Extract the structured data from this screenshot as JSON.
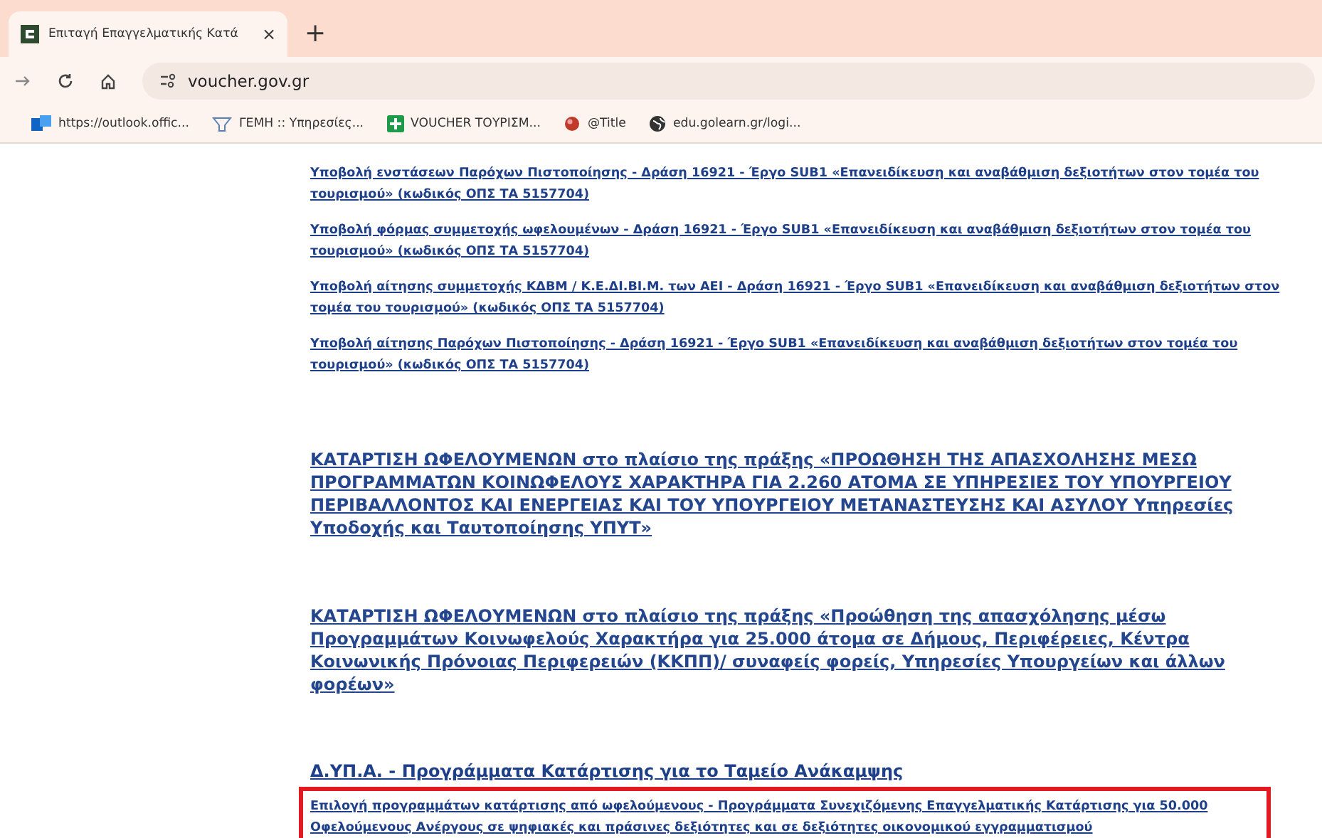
{
  "browser": {
    "tab": {
      "title": "Επιταγή Επαγγελματικής Κατά",
      "close": "×"
    },
    "new_tab": "+",
    "address": "voucher.gov.gr",
    "bookmarks": [
      {
        "label": "https://outlook.offic..."
      },
      {
        "label": "ΓΕΜΗ :: Υπηρεσίες..."
      },
      {
        "label": "VOUCHER ΤΟΥΡΙΣΜ..."
      },
      {
        "label": "@Title"
      },
      {
        "label": "edu.golearn.gr/logi..."
      }
    ]
  },
  "content": [
    {
      "kind": "link",
      "text": "Υποβολή ενστάσεων Παρόχων Πιστοποίησης - Δράση 16921 - Έργο SUB1 «Επανειδίκευση και αναβάθμιση δεξιοτήτων στον τομέα του τουρισμού» (κωδικός ΟΠΣ ΤΑ 5157704)",
      "highlighted": false
    },
    {
      "kind": "link",
      "text": "Υποβολή φόρμας συμμετοχής ωφελουμένων - Δράση 16921 - Έργο SUB1 «Επανειδίκευση και αναβάθμιση δεξιοτήτων στον τομέα του τουρισμού» (κωδικός ΟΠΣ ΤΑ 5157704)",
      "highlighted": false
    },
    {
      "kind": "link",
      "text": "Υποβολή αίτησης συμμετοχής ΚΔΒΜ / Κ.Ε.ΔΙ.ΒΙ.Μ. των ΑΕΙ - Δράση 16921 - Έργο SUB1 «Επανειδίκευση και αναβάθμιση δεξιοτήτων στον τομέα του τουρισμού» (κωδικός ΟΠΣ ΤΑ 5157704)",
      "highlighted": false
    },
    {
      "kind": "link",
      "text": "Υποβολή αίτησης Παρόχων Πιστοποίησης - Δράση 16921 - Έργο SUB1 «Επανειδίκευση και αναβάθμιση δεξιοτήτων στον τομέα του τουρισμού» (κωδικός ΟΠΣ ΤΑ 5157704)",
      "highlighted": false
    },
    {
      "kind": "heading",
      "text": "ΚΑΤΑΡΤΙΣΗ ΩΦΕΛΟΥΜΕΝΩΝ στο πλαίσιο της πράξης «ΠΡΟΩΘΗΣΗ ΤΗΣ ΑΠΑΣΧΟΛΗΣΗΣ ΜΕΣΩ ΠΡΟΓΡΑΜΜΑΤΩΝ ΚΟΙΝΩΦΕΛΟΥΣ ΧΑΡΑΚΤΗΡΑ ΓΙΑ 2.260 ΑΤΟΜΑ ΣΕ ΥΠΗΡΕΣΙΕΣ ΤΟΥ ΥΠΟΥΡΓΕΙΟΥ ΠΕΡΙΒΑΛΛΟΝΤΟΣ ΚΑΙ ΕΝΕΡΓΕΙΑΣ ΚΑΙ ΤΟΥ ΥΠΟΥΡΓΕΙΟΥ ΜΕΤΑΝΑΣΤΕΥΣΗΣ ΚΑΙ ΑΣΥΛΟΥ Υπηρεσίες Υποδοχής και Ταυτοποίησης ΥΠΥΤ»",
      "highlighted": false
    },
    {
      "kind": "heading",
      "text": "ΚΑΤΑΡΤΙΣΗ ΩΦΕΛΟΥΜΕΝΩΝ στο πλαίσιο της πράξης «Προώθηση της απασχόλησης μέσω Προγραμμάτων Κοινωφελούς Χαρακτήρα για 25.000 άτομα σε Δήμους, Περιφέρειες, Κέντρα Κοινωνικής Πρόνοιας Περιφερειών (ΚΚΠΠ)/ συναφείς φορείς, Υπηρεσίες Υπουργείων και άλλων φορέων»",
      "highlighted": false
    },
    {
      "kind": "section",
      "text": "Δ.ΥΠ.Α. - Προγράμματα Κατάρτισης για το Ταμείο Ανάκαμψης",
      "highlighted": false
    },
    {
      "kind": "link",
      "text": "Επιλογή προγραμμάτων κατάρτισης από ωφελούμενους - Προγράμματα Συνεχιζόμενης Επαγγελματικής Κατάρτισης για 50.000 Οφελούμενους Ανέργους σε ψηφιακές και πράσινες δεξιότητες και σε δεξιότητες οικονομικού εγγραμματισμού",
      "highlighted": true
    }
  ]
}
